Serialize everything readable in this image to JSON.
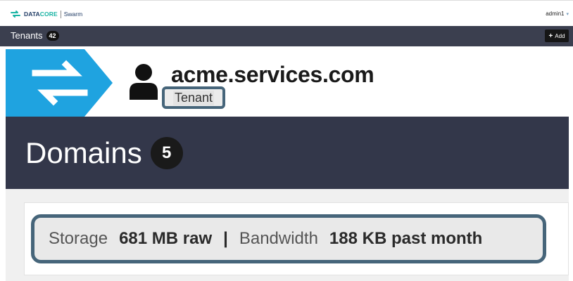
{
  "app": {
    "brand": "DATACORE",
    "brand_accent": "CORE",
    "product": "Swarm",
    "user": "admin1",
    "colors": {
      "brand_navy": "#1f3b64",
      "brand_teal": "#17b3a3",
      "chevron_blue": "#1fa3e0",
      "highlight_ring": "#46657a"
    }
  },
  "tenants_bar": {
    "title": "Tenants",
    "count": "42",
    "add_label": "Add"
  },
  "tenant": {
    "name": "acme.services.com",
    "type_label": "Tenant",
    "icon": "person-icon"
  },
  "domains": {
    "title": "Domains",
    "count": "5"
  },
  "stats": {
    "storage_label": "Storage",
    "storage_value": "681 MB raw",
    "separator": "|",
    "bandwidth_label": "Bandwidth",
    "bandwidth_value": "188 KB past month"
  }
}
